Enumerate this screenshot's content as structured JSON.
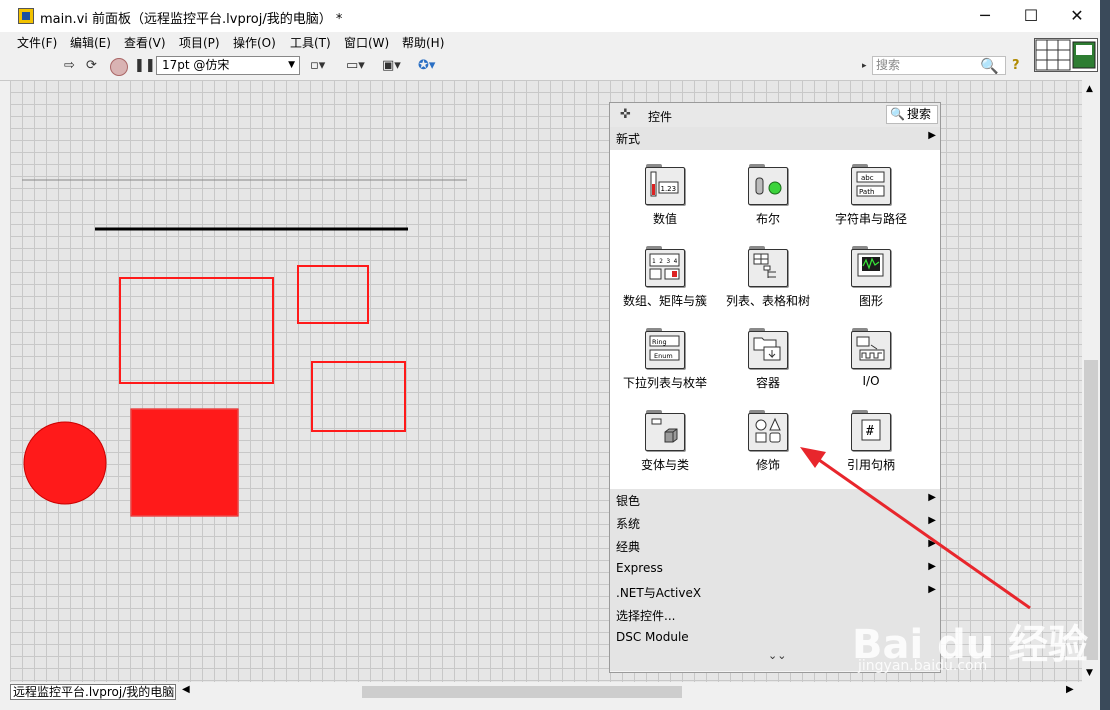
{
  "window": {
    "title": "main.vi 前面板（远程监控平台.lvproj/我的电脑） *",
    "buttons": [
      "─",
      "☐",
      "✕"
    ]
  },
  "menu": [
    "文件(F)",
    "编辑(E)",
    "查看(V)",
    "项目(P)",
    "操作(O)",
    "工具(T)",
    "窗口(W)",
    "帮助(H)"
  ],
  "toolbar": {
    "font_value": "17pt @仿宋",
    "search_placeholder": "搜索",
    "help_label": "?"
  },
  "palette": {
    "title": "控件",
    "search_label": "搜索",
    "header_category": "新式",
    "items": [
      "数值",
      "布尔",
      "字符串与路径",
      "数组、矩阵与簇",
      "列表、表格和树",
      "图形",
      "下拉列表与枚举",
      "容器",
      "I/O",
      "变体与类",
      "修饰",
      "引用句柄"
    ],
    "categories": [
      "银色",
      "系统",
      "经典",
      "Express",
      ".NET与ActiveX",
      "选择控件...",
      "DSC Module"
    ],
    "glyphs": {
      "numeric": "1.23",
      "string": "abc",
      "path": "Path",
      "ring": "Ring",
      "enum": "Enum",
      "ref": "#",
      "array": "1 2 3 4"
    }
  },
  "statusbar": {
    "path": "远程监控平台.lvproj/我的电脑"
  },
  "colors": {
    "decoration_red": "#ff1a1a",
    "annotation_arrow": "#e8262c"
  },
  "watermark": {
    "brand": "Bai du 经验",
    "url": "jingyan.baidu.com"
  }
}
